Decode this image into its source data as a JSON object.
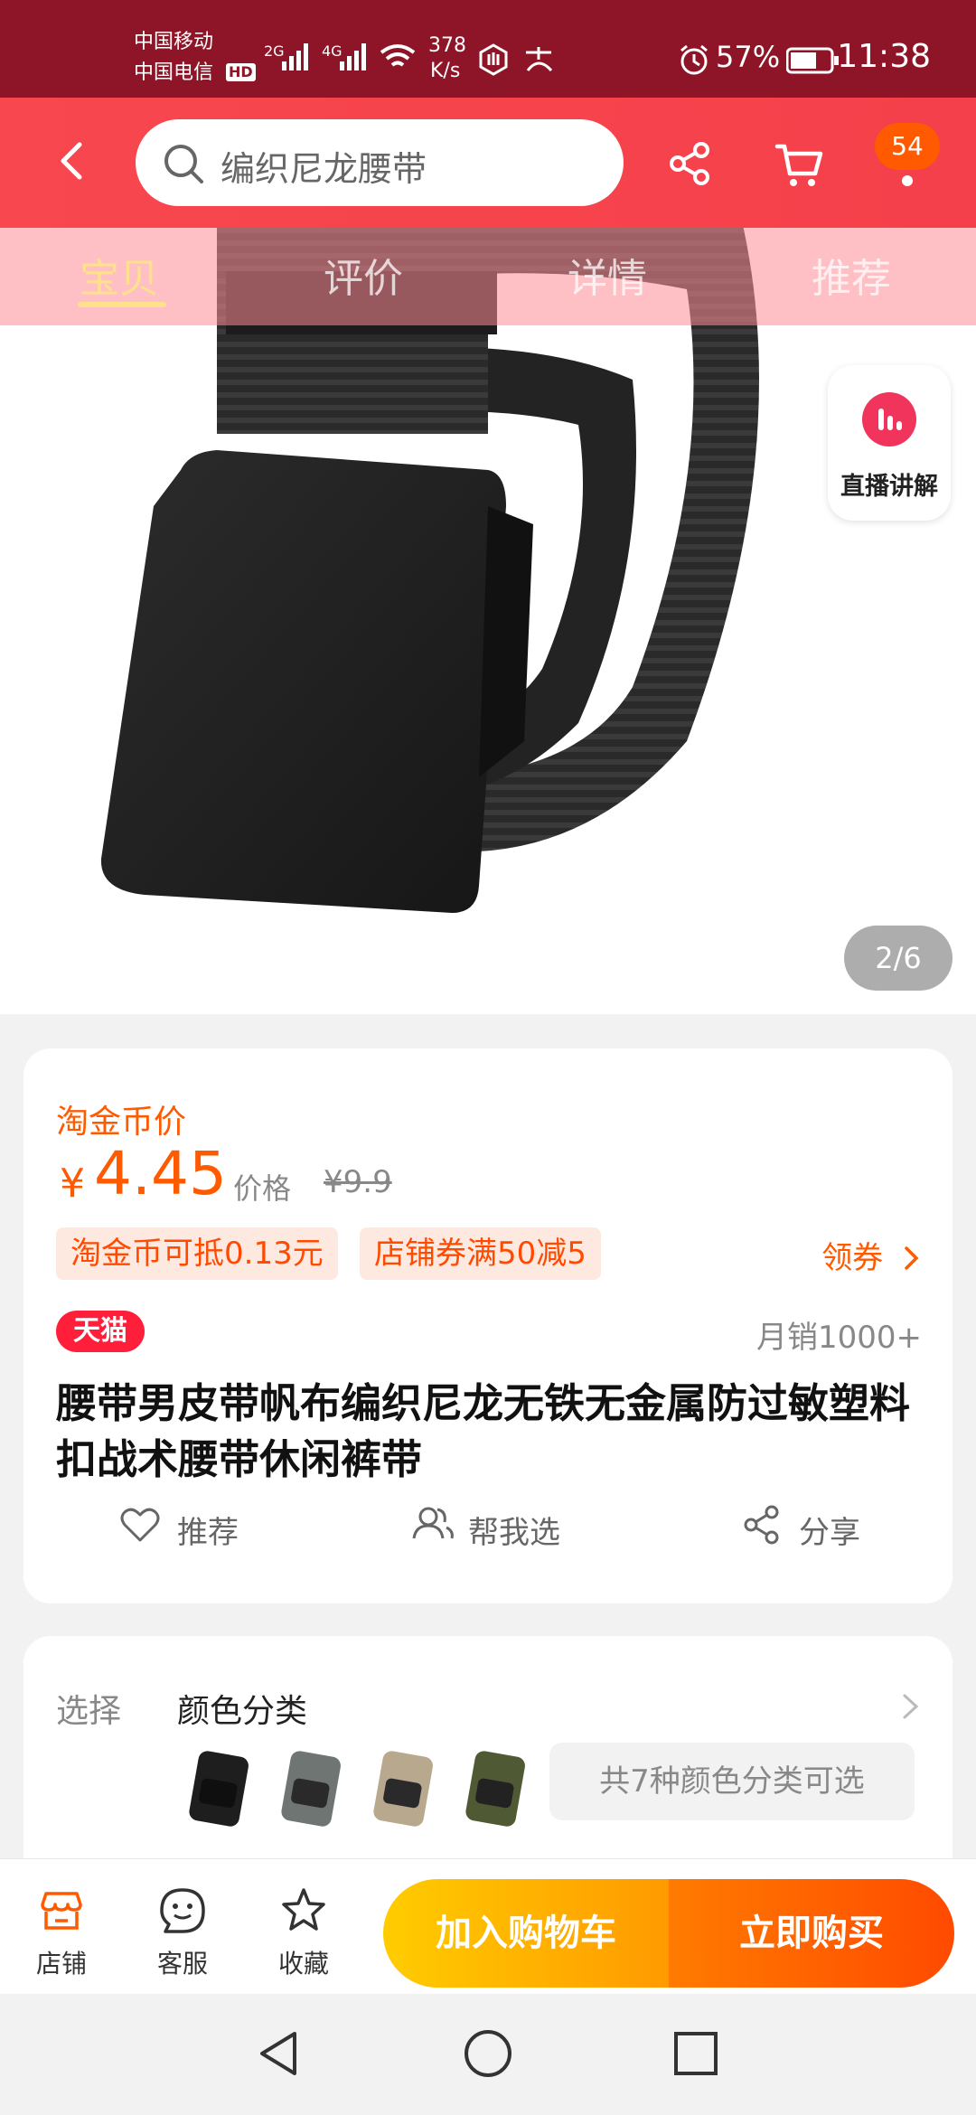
{
  "status_bar": {
    "carrier_1": "中国移动",
    "carrier_2": "中国电信",
    "hd": "HD",
    "net_2g": "2G",
    "net_4g": "4G",
    "speed_value": "378",
    "speed_unit": "K/s",
    "battery_pct": "57%",
    "time": "11:38"
  },
  "nav": {
    "search_text": "编织尼龙腰带",
    "cart_badge": "54"
  },
  "tabs": [
    "宝贝",
    "评价",
    "详情",
    "推荐"
  ],
  "live_button": {
    "label": "直播讲解"
  },
  "pager": "2/6",
  "price": {
    "label": "淘金币价",
    "yen": "¥",
    "value": "4.45",
    "orig_label": "价格",
    "orig_value": "¥9.9"
  },
  "promos": [
    "淘金币可抵0.13元",
    "店铺券满50减5"
  ],
  "coupon_link": "领券",
  "tmall_badge": "天猫",
  "monthly_sales": "月销1000+",
  "product_title": "腰带男皮带帆布编织尼龙无铁无金属防过敏塑料扣战术腰带休闲裤带",
  "actions": [
    "推荐",
    "帮我选",
    "分享"
  ],
  "select": {
    "label": "选择",
    "category": "颜色分类",
    "count_text": "共7种颜色分类可选",
    "swatch_colors": [
      "#1e1e1e",
      "#6f7573",
      "#b8a88e",
      "#4f5a35"
    ]
  },
  "bottom_bar": {
    "store": "店铺",
    "service": "客服",
    "favorite": "收藏",
    "add_to_cart": "加入购物车",
    "buy_now": "立即购买"
  },
  "colors": {
    "brand_red": "#f4404a",
    "accent_orange": "#ff5a00",
    "tab_active": "#ffe08c"
  }
}
